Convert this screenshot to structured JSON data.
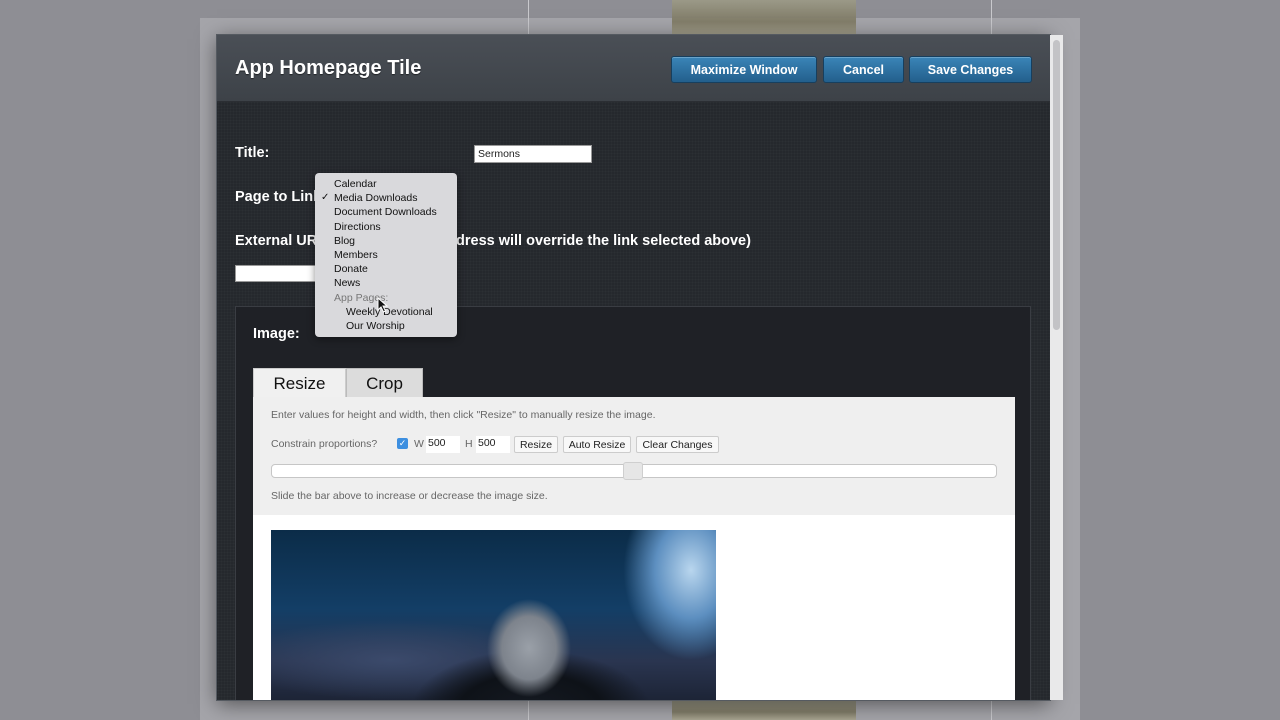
{
  "window": {
    "title": "App Homepage Tile",
    "buttons": {
      "maximize": "Maximize Window",
      "cancel": "Cancel",
      "save": "Save Changes"
    }
  },
  "form": {
    "title_label": "Title:",
    "title_value": "Sermons",
    "page_label": "Page to Link",
    "external_label": "External UR",
    "external_hint": "dress will override the link selected above)",
    "external_value": "",
    "image_label": "Image:"
  },
  "dropdown": {
    "items": [
      {
        "label": "Calendar",
        "checked": false
      },
      {
        "label": "Media Downloads",
        "checked": true
      },
      {
        "label": "Document Downloads",
        "checked": false
      },
      {
        "label": "Directions",
        "checked": false
      },
      {
        "label": "Blog",
        "checked": false
      },
      {
        "label": "Members",
        "checked": false
      },
      {
        "label": "Donate",
        "checked": false
      },
      {
        "label": "News",
        "checked": false
      }
    ],
    "group_label": "App Pages:",
    "sub_items": [
      "Weekly Devotional",
      "Our Worship"
    ],
    "check_glyph": "✓"
  },
  "image_editor": {
    "tabs": [
      "Resize",
      "Crop"
    ],
    "instructions": "Enter values for height and width, then click \"Resize\" to manually resize the image.",
    "constrain_label": "Constrain proportions?",
    "width_label": "W",
    "width_value": "500",
    "height_label": "H",
    "height_value": "500",
    "buttons": {
      "resize": "Resize",
      "auto_resize": "Auto Resize",
      "clear": "Clear Changes"
    },
    "slider_level": 0.5,
    "slider_help": "Slide the bar above to increase or decrease the image size."
  },
  "colors": {
    "accent_button": "#2f77a8",
    "checkbox": "#3d8fe0",
    "modal_bg": "#25282d"
  },
  "icons": {
    "check": "checkmark-icon",
    "cursor": "mouse-pointer-icon"
  }
}
